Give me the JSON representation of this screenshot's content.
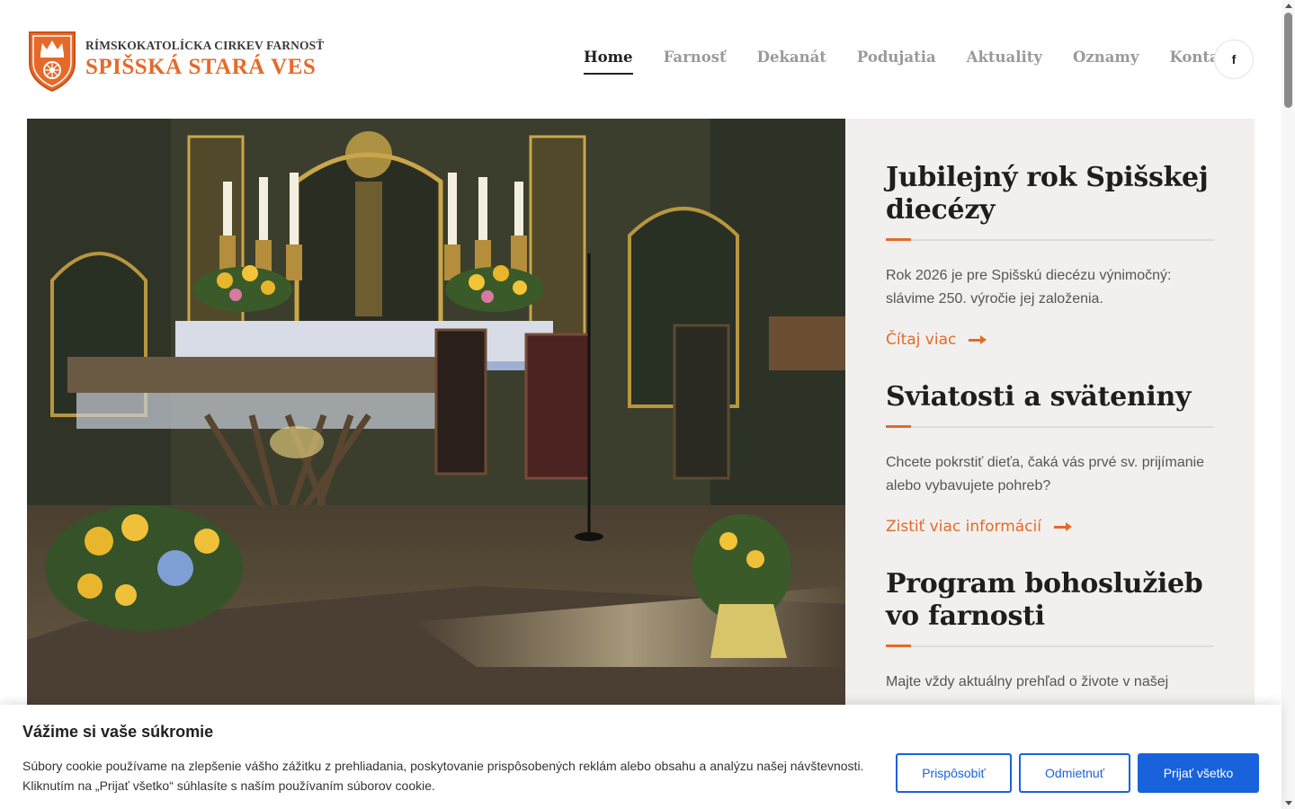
{
  "header": {
    "logo_line1": "RÍMSKOKATOLÍCKA CIRKEV FARNOSŤ",
    "logo_line2": "SPIŠSKÁ STARÁ VES",
    "nav": [
      "Home",
      "Farnosť",
      "Dekanát",
      "Podujatia",
      "Aktuality",
      "Oznamy",
      "Kontakt"
    ],
    "active_nav": "Home",
    "facebook_label": "f"
  },
  "hero": {
    "image": "church-altar-photo"
  },
  "panel": {
    "blocks": [
      {
        "title": "Jubilejný rok Spišskej diecézy",
        "text": "Rok 2026 je pre Spišskú diecézu výnimočný: slávime 250. výročie jej založenia.",
        "link": "Čítaj viac"
      },
      {
        "title": "Sviatosti a sväteniny",
        "text": "Chcete pokrstiť dieťa, čaká vás prvé sv. prijímanie alebo vybavujete pohreb?",
        "link": "Zistiť viac informácií"
      },
      {
        "title": "Program bohoslužieb vo farnosti",
        "text": "Majte vždy aktuálny prehľad o živote v našej",
        "link": ""
      }
    ]
  },
  "cookie": {
    "title": "Vážime si vaše súkromie",
    "text": "Súbory cookie používame na zlepšenie vášho zážitku z prehliadania, poskytovanie prispôsobených reklám alebo obsahu a analýzu našej návštevnosti. Kliknutím na „Prijať všetko“ súhlasíte s naším používaním súborov cookie.",
    "btn_customize": "Prispôsobiť",
    "btn_reject": "Odmietnuť",
    "btn_accept": "Prijať všetko"
  },
  "colors": {
    "accent": "#e56a2a",
    "cookie_blue": "#1863dc",
    "panel_bg": "#f1f0ee"
  }
}
